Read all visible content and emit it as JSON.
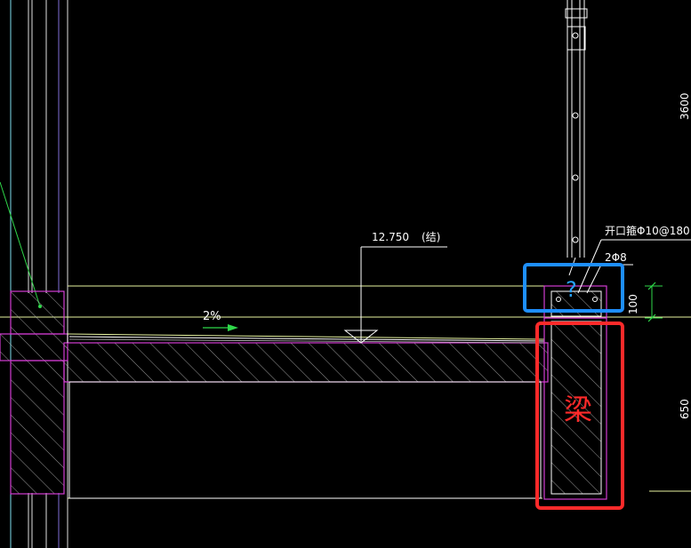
{
  "labels": {
    "elevation": "12.750",
    "elevation_note": "(结)",
    "slope": "2%",
    "rebar_spec": "开口箍Φ10@180",
    "rebar_top": "2Φ8",
    "dim_100": "100",
    "dim_650": "650",
    "dim_3600": "3600",
    "question": "?",
    "beam": "梁"
  },
  "colors": {
    "background": "#000000",
    "magenta": "#d23cd2",
    "hatch": "#c8c8c8",
    "white": "#ffffff",
    "green": "#2fd84a",
    "yellow_green": "#e8f5a0",
    "cyan": "#27c9e6",
    "blue_box": "#1e8fff",
    "red_box": "#ff2a2a"
  }
}
